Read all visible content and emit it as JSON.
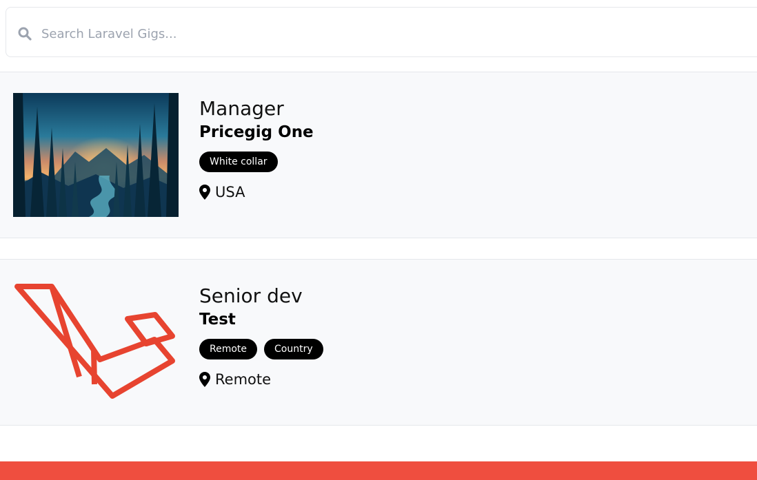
{
  "search": {
    "placeholder": "Search Laravel Gigs..."
  },
  "listings": [
    {
      "title": "Manager",
      "company": "Pricegig One",
      "tags": [
        "White collar"
      ],
      "location": "USA",
      "image_icon": "forest-landscape-image"
    },
    {
      "title": "Senior dev",
      "company": "Test",
      "tags": [
        "Remote",
        "Country"
      ],
      "location": "Remote",
      "image_icon": "laravel-logo-icon"
    }
  ],
  "colors": {
    "accent": "#ef4e3f",
    "card_bg": "#f8f9fb",
    "tag_bg": "#000000",
    "placeholder": "#9ca3af",
    "laravel_red": "#e74430"
  }
}
